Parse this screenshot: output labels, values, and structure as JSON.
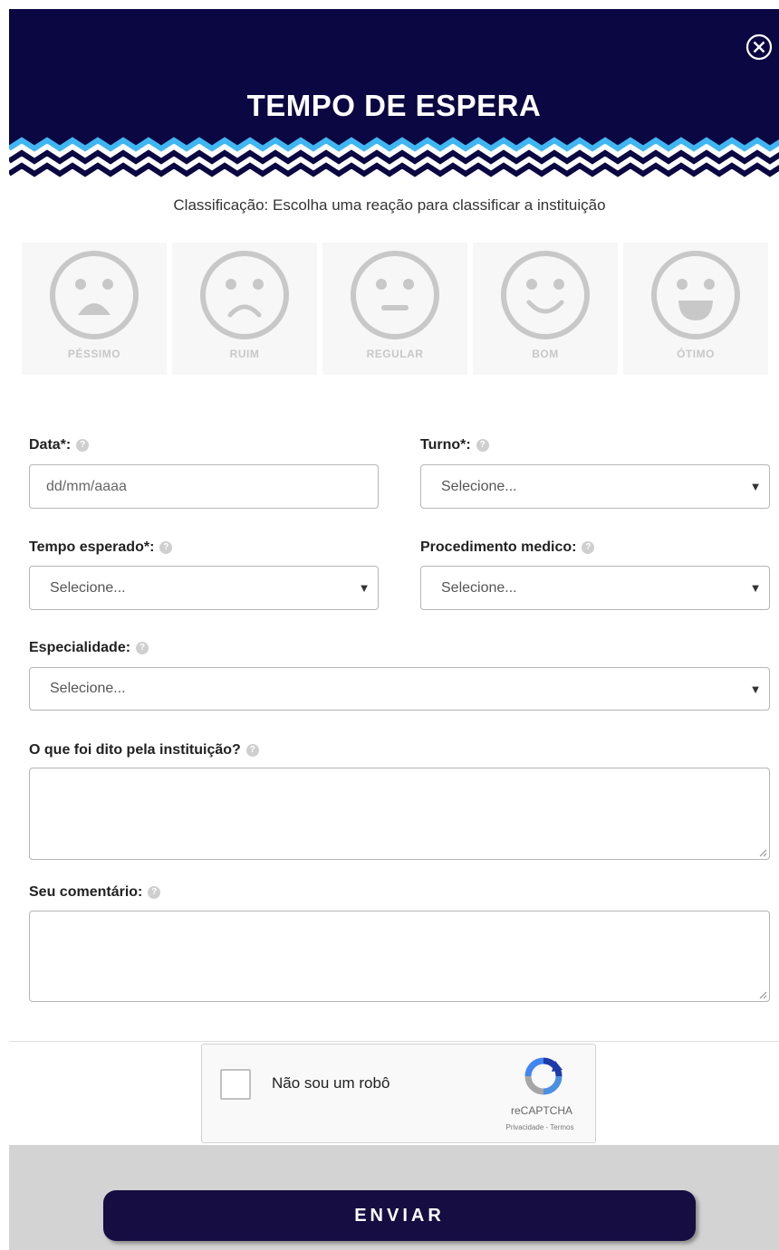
{
  "header": {
    "title": "TEMPO DE ESPERA",
    "close_icon": "close-circle-icon",
    "bg_color": "#0b0742",
    "zigzag_color": "#3fb6f2"
  },
  "rating": {
    "prompt": "Classificação: Escolha uma reação para classificar a instituição",
    "options": [
      {
        "label": "PÉSSIMO",
        "icon": "face-terrible-icon"
      },
      {
        "label": "RUIM",
        "icon": "face-sad-icon"
      },
      {
        "label": "REGULAR",
        "icon": "face-neutral-icon"
      },
      {
        "label": "BOM",
        "icon": "face-smile-icon"
      },
      {
        "label": "ÓTIMO",
        "icon": "face-happy-icon"
      }
    ]
  },
  "form": {
    "data": {
      "label": "Data*:",
      "placeholder": "dd/mm/aaaa"
    },
    "turno": {
      "label": "Turno*:",
      "value": "Selecione..."
    },
    "tempo": {
      "label": "Tempo esperado*:",
      "value": "Selecione..."
    },
    "procedimento": {
      "label": "Procedimento medico:",
      "value": "Selecione..."
    },
    "especialidade": {
      "label": "Especialidade:",
      "value": "Selecione..."
    },
    "dito": {
      "label": "O que foi dito pela instituição?",
      "value": ""
    },
    "comentario": {
      "label": "Seu comentário:",
      "value": ""
    },
    "help_glyph": "?",
    "caret_glyph": "▼"
  },
  "captcha": {
    "label": "Não sou um robô",
    "brand": "reCAPTCHA",
    "links": "Privacidade - Termos"
  },
  "submit": {
    "label": "ENVIAR",
    "color": "#160d43"
  }
}
